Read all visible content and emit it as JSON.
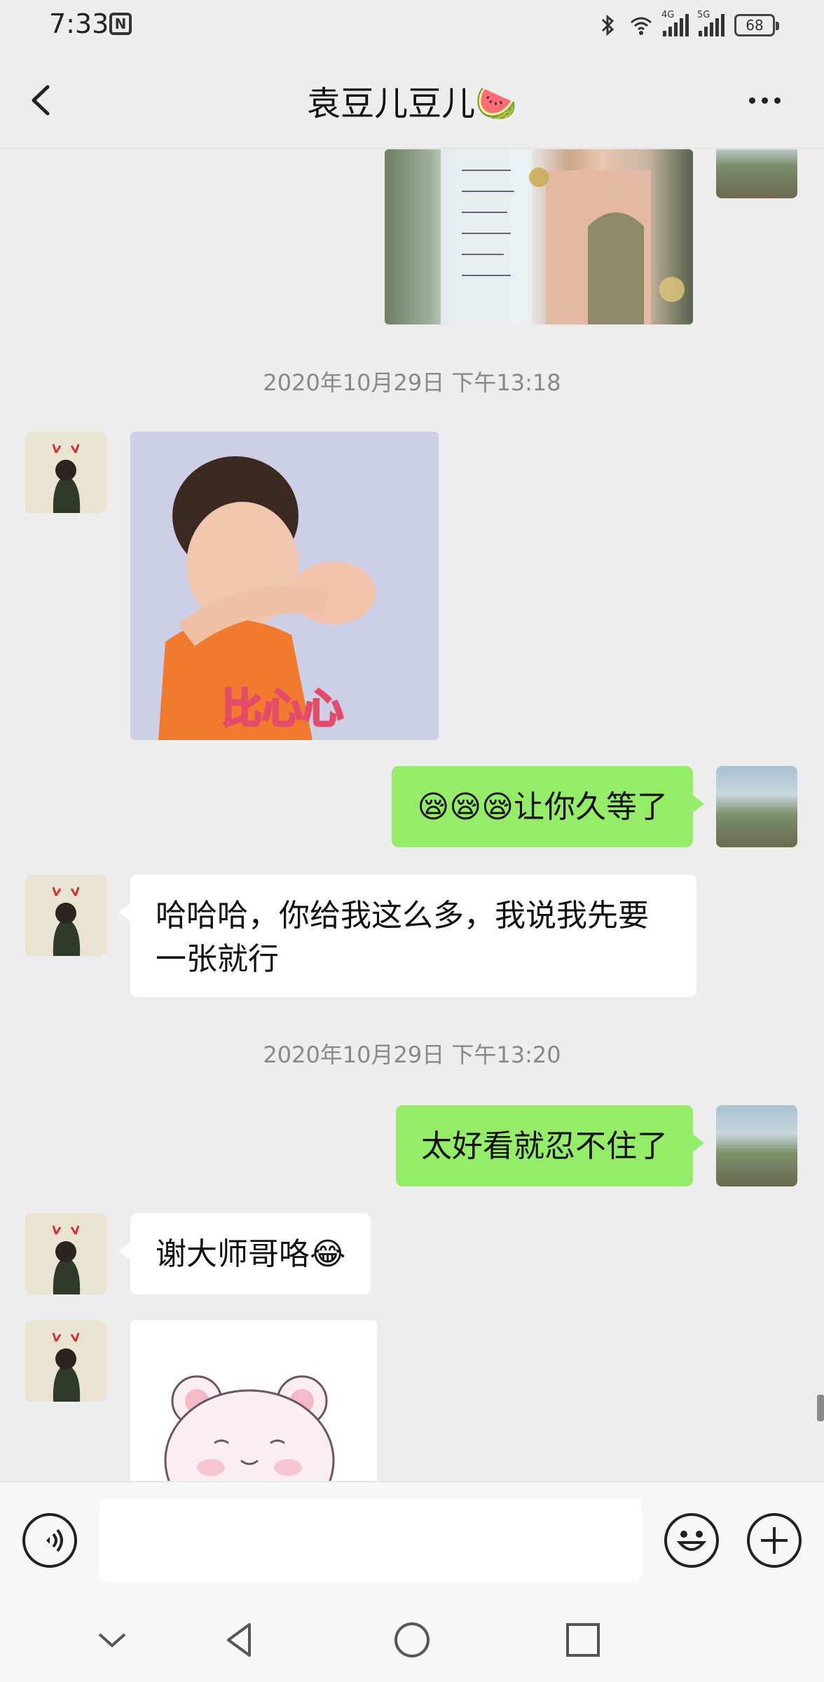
{
  "status_bar": {
    "time": "7:33",
    "battery": "68",
    "net_4g": "4G",
    "net_5g": "5G"
  },
  "header": {
    "title": "袁豆儿豆儿🍉"
  },
  "messages": {
    "ts1": "2020年10月29日 下午13:18",
    "msg_me_1": "😪😪😪让你久等了",
    "msg_other_1": "哈哈哈，你给我这么多，我说我先要一张就行",
    "ts2": "2020年10月29日 下午13:20",
    "msg_me_2": "太好看就忍不住了",
    "msg_other_2": "谢大师哥咯😂",
    "sticker_text": "比心心"
  },
  "input": {
    "placeholder": ""
  },
  "colors": {
    "my_bubble": "#95ec69",
    "other_bubble": "#ffffff",
    "background": "#ededed"
  }
}
